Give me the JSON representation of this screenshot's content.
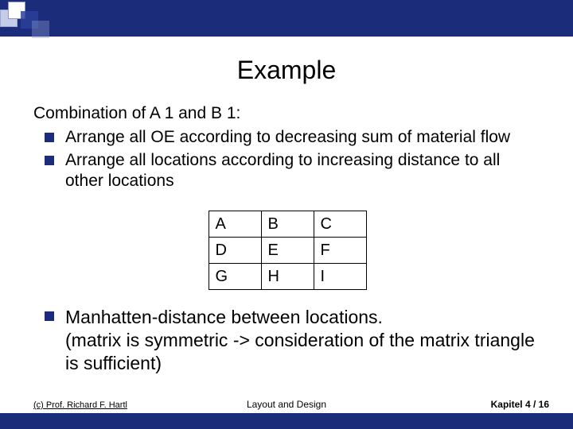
{
  "title": "Example",
  "intro": "Combination of A 1 and B 1:",
  "bullets_top": [
    "Arrange all OE according to decreasing sum of material flow",
    "Arrange all locations according to increasing distance to all other locations"
  ],
  "grid": [
    [
      "A",
      "B",
      "C"
    ],
    [
      "D",
      "E",
      "F"
    ],
    [
      "G",
      "H",
      "I"
    ]
  ],
  "bullets_bottom": [
    "Manhatten-distance between locations.\n(matrix is symmetric -> consideration of the matrix triangle is sufficient)"
  ],
  "footer": {
    "left": "(c) Prof. Richard F. Hartl",
    "center": "Layout and Design",
    "right": "Kapitel 4 /  16"
  },
  "colors": {
    "navy": "#1b2c7a"
  }
}
